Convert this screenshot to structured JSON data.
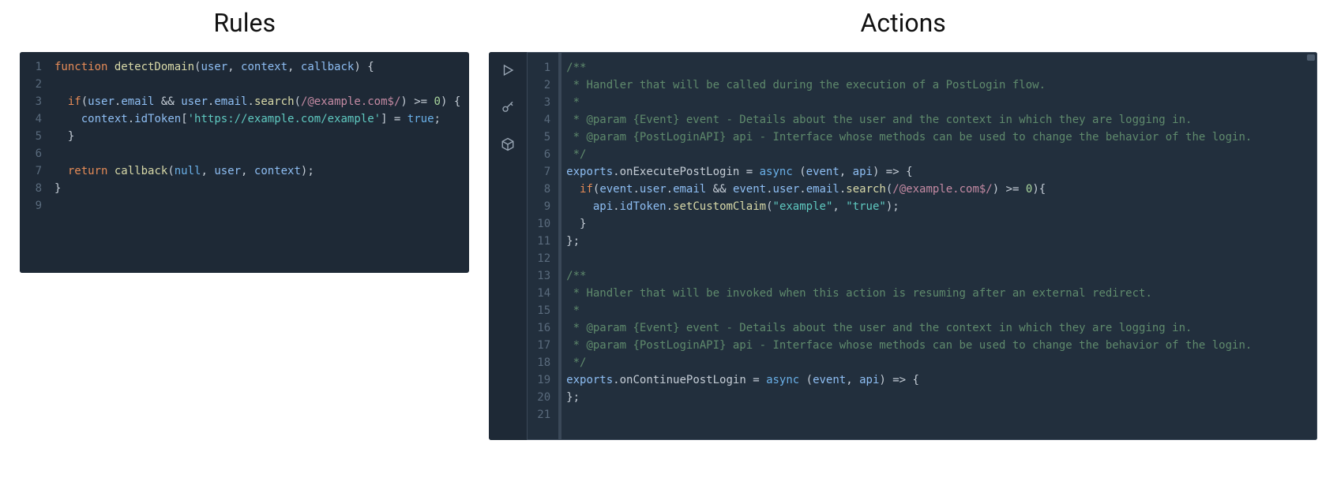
{
  "left": {
    "title": "Rules",
    "lines": [
      {
        "num": 1,
        "tokens": [
          {
            "t": "function ",
            "c": "tok-keyword"
          },
          {
            "t": "detectDomain",
            "c": "tok-func"
          },
          {
            "t": "(",
            "c": "tok-plain"
          },
          {
            "t": "user",
            "c": "tok-param"
          },
          {
            "t": ", ",
            "c": "tok-plain"
          },
          {
            "t": "context",
            "c": "tok-param"
          },
          {
            "t": ", ",
            "c": "tok-plain"
          },
          {
            "t": "callback",
            "c": "tok-param"
          },
          {
            "t": ") {",
            "c": "tok-plain"
          }
        ]
      },
      {
        "num": 2,
        "tokens": []
      },
      {
        "num": 3,
        "tokens": [
          {
            "t": "  ",
            "c": "tok-plain"
          },
          {
            "t": "if",
            "c": "tok-keyword"
          },
          {
            "t": "(",
            "c": "tok-plain"
          },
          {
            "t": "user",
            "c": "tok-param"
          },
          {
            "t": ".",
            "c": "tok-plain"
          },
          {
            "t": "email",
            "c": "tok-param"
          },
          {
            "t": " && ",
            "c": "tok-plain"
          },
          {
            "t": "user",
            "c": "tok-param"
          },
          {
            "t": ".",
            "c": "tok-plain"
          },
          {
            "t": "email",
            "c": "tok-param"
          },
          {
            "t": ".",
            "c": "tok-plain"
          },
          {
            "t": "search",
            "c": "tok-func"
          },
          {
            "t": "(",
            "c": "tok-plain"
          },
          {
            "t": "/@example.com$/",
            "c": "tok-regex"
          },
          {
            "t": ") >= ",
            "c": "tok-plain"
          },
          {
            "t": "0",
            "c": "tok-number"
          },
          {
            "t": ") {",
            "c": "tok-plain"
          }
        ]
      },
      {
        "num": 4,
        "tokens": [
          {
            "t": "    ",
            "c": "tok-plain"
          },
          {
            "t": "context",
            "c": "tok-param"
          },
          {
            "t": ".",
            "c": "tok-plain"
          },
          {
            "t": "idToken",
            "c": "tok-param"
          },
          {
            "t": "[",
            "c": "tok-plain"
          },
          {
            "t": "'https://example.com/example'",
            "c": "tok-string"
          },
          {
            "t": "] = ",
            "c": "tok-plain"
          },
          {
            "t": "true",
            "c": "tok-bool"
          },
          {
            "t": ";",
            "c": "tok-plain"
          }
        ]
      },
      {
        "num": 5,
        "tokens": [
          {
            "t": "  }",
            "c": "tok-plain"
          }
        ]
      },
      {
        "num": 6,
        "tokens": []
      },
      {
        "num": 7,
        "tokens": [
          {
            "t": "  ",
            "c": "tok-plain"
          },
          {
            "t": "return ",
            "c": "tok-keyword"
          },
          {
            "t": "callback",
            "c": "tok-func"
          },
          {
            "t": "(",
            "c": "tok-plain"
          },
          {
            "t": "null",
            "c": "tok-bool"
          },
          {
            "t": ", ",
            "c": "tok-plain"
          },
          {
            "t": "user",
            "c": "tok-param"
          },
          {
            "t": ", ",
            "c": "tok-plain"
          },
          {
            "t": "context",
            "c": "tok-param"
          },
          {
            "t": ");",
            "c": "tok-plain"
          }
        ]
      },
      {
        "num": 8,
        "tokens": [
          {
            "t": "}",
            "c": "tok-plain"
          }
        ]
      },
      {
        "num": 9,
        "tokens": []
      }
    ]
  },
  "right": {
    "title": "Actions",
    "lines": [
      {
        "num": 1,
        "tokens": [
          {
            "t": "/**",
            "c": "tok-comment"
          }
        ]
      },
      {
        "num": 2,
        "tokens": [
          {
            "t": " * Handler that will be called during the execution of a PostLogin flow.",
            "c": "tok-comment"
          }
        ]
      },
      {
        "num": 3,
        "tokens": [
          {
            "t": " *",
            "c": "tok-comment"
          }
        ]
      },
      {
        "num": 4,
        "tokens": [
          {
            "t": " * @param {Event} event - Details about the user and the context in which they are logging in.",
            "c": "tok-comment"
          }
        ]
      },
      {
        "num": 5,
        "tokens": [
          {
            "t": " * @param {PostLoginAPI} api - Interface whose methods can be used to change the behavior of the login.",
            "c": "tok-comment"
          }
        ]
      },
      {
        "num": 6,
        "tokens": [
          {
            "t": " */",
            "c": "tok-comment"
          }
        ]
      },
      {
        "num": 7,
        "tokens": [
          {
            "t": "exports",
            "c": "tok-param"
          },
          {
            "t": ".",
            "c": "tok-plain"
          },
          {
            "t": "onExecutePostLogin",
            "c": "tok-plain"
          },
          {
            "t": " = ",
            "c": "tok-plain"
          },
          {
            "t": "async ",
            "c": "tok-keyword2"
          },
          {
            "t": "(",
            "c": "tok-plain"
          },
          {
            "t": "event",
            "c": "tok-param"
          },
          {
            "t": ", ",
            "c": "tok-plain"
          },
          {
            "t": "api",
            "c": "tok-param"
          },
          {
            "t": ") => {",
            "c": "tok-plain"
          }
        ]
      },
      {
        "num": 8,
        "tokens": [
          {
            "t": "  ",
            "c": "tok-plain"
          },
          {
            "t": "if",
            "c": "tok-keyword"
          },
          {
            "t": "(",
            "c": "tok-plain"
          },
          {
            "t": "event",
            "c": "tok-param"
          },
          {
            "t": ".",
            "c": "tok-plain"
          },
          {
            "t": "user",
            "c": "tok-param"
          },
          {
            "t": ".",
            "c": "tok-plain"
          },
          {
            "t": "email",
            "c": "tok-param"
          },
          {
            "t": " && ",
            "c": "tok-plain"
          },
          {
            "t": "event",
            "c": "tok-param"
          },
          {
            "t": ".",
            "c": "tok-plain"
          },
          {
            "t": "user",
            "c": "tok-param"
          },
          {
            "t": ".",
            "c": "tok-plain"
          },
          {
            "t": "email",
            "c": "tok-param"
          },
          {
            "t": ".",
            "c": "tok-plain"
          },
          {
            "t": "search",
            "c": "tok-func"
          },
          {
            "t": "(",
            "c": "tok-plain"
          },
          {
            "t": "/@example.com$/",
            "c": "tok-regex"
          },
          {
            "t": ") >= ",
            "c": "tok-plain"
          },
          {
            "t": "0",
            "c": "tok-number"
          },
          {
            "t": "){",
            "c": "tok-plain"
          }
        ]
      },
      {
        "num": 9,
        "tokens": [
          {
            "t": "    ",
            "c": "tok-plain"
          },
          {
            "t": "api",
            "c": "tok-param"
          },
          {
            "t": ".",
            "c": "tok-plain"
          },
          {
            "t": "idToken",
            "c": "tok-param"
          },
          {
            "t": ".",
            "c": "tok-plain"
          },
          {
            "t": "setCustomClaim",
            "c": "tok-func"
          },
          {
            "t": "(",
            "c": "tok-plain"
          },
          {
            "t": "\"example\"",
            "c": "tok-string"
          },
          {
            "t": ", ",
            "c": "tok-plain"
          },
          {
            "t": "\"true\"",
            "c": "tok-string"
          },
          {
            "t": ");",
            "c": "tok-plain"
          }
        ]
      },
      {
        "num": 10,
        "tokens": [
          {
            "t": "  }",
            "c": "tok-plain"
          }
        ]
      },
      {
        "num": 11,
        "tokens": [
          {
            "t": "};",
            "c": "tok-plain"
          }
        ]
      },
      {
        "num": 12,
        "tokens": []
      },
      {
        "num": 13,
        "tokens": [
          {
            "t": "/**",
            "c": "tok-comment"
          }
        ]
      },
      {
        "num": 14,
        "tokens": [
          {
            "t": " * Handler that will be invoked when this action is resuming after an external redirect.",
            "c": "tok-comment"
          }
        ]
      },
      {
        "num": 15,
        "tokens": [
          {
            "t": " *",
            "c": "tok-comment"
          }
        ]
      },
      {
        "num": 16,
        "tokens": [
          {
            "t": " * @param {Event} event - Details about the user and the context in which they are logging in.",
            "c": "tok-comment"
          }
        ]
      },
      {
        "num": 17,
        "tokens": [
          {
            "t": " * @param {PostLoginAPI} api - Interface whose methods can be used to change the behavior of the login.",
            "c": "tok-comment"
          }
        ]
      },
      {
        "num": 18,
        "tokens": [
          {
            "t": " */",
            "c": "tok-comment"
          }
        ]
      },
      {
        "num": 19,
        "tokens": [
          {
            "t": "exports",
            "c": "tok-param"
          },
          {
            "t": ".",
            "c": "tok-plain"
          },
          {
            "t": "onContinuePostLogin",
            "c": "tok-plain"
          },
          {
            "t": " = ",
            "c": "tok-plain"
          },
          {
            "t": "async ",
            "c": "tok-keyword2"
          },
          {
            "t": "(",
            "c": "tok-plain"
          },
          {
            "t": "event",
            "c": "tok-param"
          },
          {
            "t": ", ",
            "c": "tok-plain"
          },
          {
            "t": "api",
            "c": "tok-param"
          },
          {
            "t": ") => {",
            "c": "tok-plain"
          }
        ]
      },
      {
        "num": 20,
        "tokens": [
          {
            "t": "};",
            "c": "tok-plain"
          }
        ]
      },
      {
        "num": 21,
        "tokens": []
      }
    ]
  }
}
